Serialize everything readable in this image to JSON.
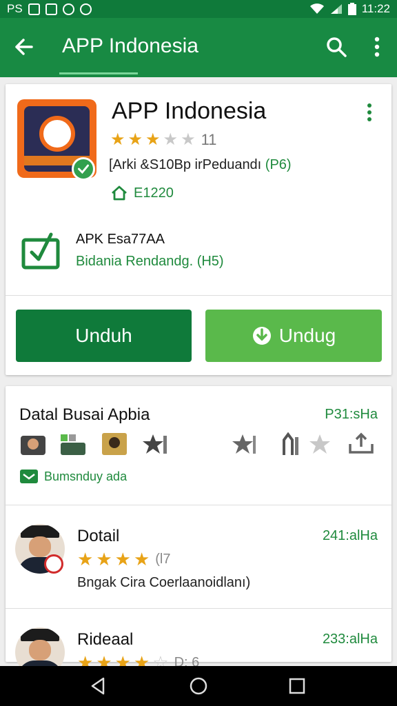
{
  "status_bar": {
    "left_text": "PS",
    "time": "11:22",
    "icons": [
      "image-icon",
      "photo-icon",
      "sync-icon",
      "app-icon",
      "wifi-icon",
      "signal-icon",
      "battery-icon"
    ]
  },
  "app_bar": {
    "title": "APP Indonesia",
    "icons": [
      "back-arrow-icon",
      "search-icon",
      "more-vertical-icon"
    ]
  },
  "app_card": {
    "name": "APP Indonesia",
    "rating_stars": 3,
    "rating_count": "11",
    "meta_prefix": "[Arki &S10Bp irPeduandı ",
    "meta_accent": "(P6)",
    "installs": "E1220",
    "apk_title": "APK Esa77AA",
    "apk_subtitle": "Bidania Rendandg. (H5)",
    "primary_button": "Unduh",
    "secondary_button": "Undug",
    "colors": {
      "primary": "#0f7a3a",
      "secondary": "#5ab94b",
      "accent_text": "#1f8a3d",
      "star": "#e8a317"
    }
  },
  "detail_card": {
    "title": "Datal Busai Apbia",
    "time": "P31:sHa",
    "tag": "Bumsnduy ada",
    "icons": [
      "thumbnail-icon",
      "thumbnail-icon",
      "thumbnail-icon",
      "star-icon",
      "star-icon",
      "share-icon",
      "star-icon",
      "upload-icon"
    ]
  },
  "reviews": [
    {
      "name": "Dotail",
      "time": "241:alHa",
      "stars": 4,
      "count": "(l7",
      "text": "Bngak Cira Coerlaanoidlanı)"
    },
    {
      "name": "Rideaal",
      "time": "233:alHa",
      "stars": 4,
      "count": "D: 6",
      "text": ""
    }
  ],
  "nav_bar": {
    "icons": [
      "back-triangle-icon",
      "home-circle-icon",
      "recents-square-icon"
    ]
  }
}
